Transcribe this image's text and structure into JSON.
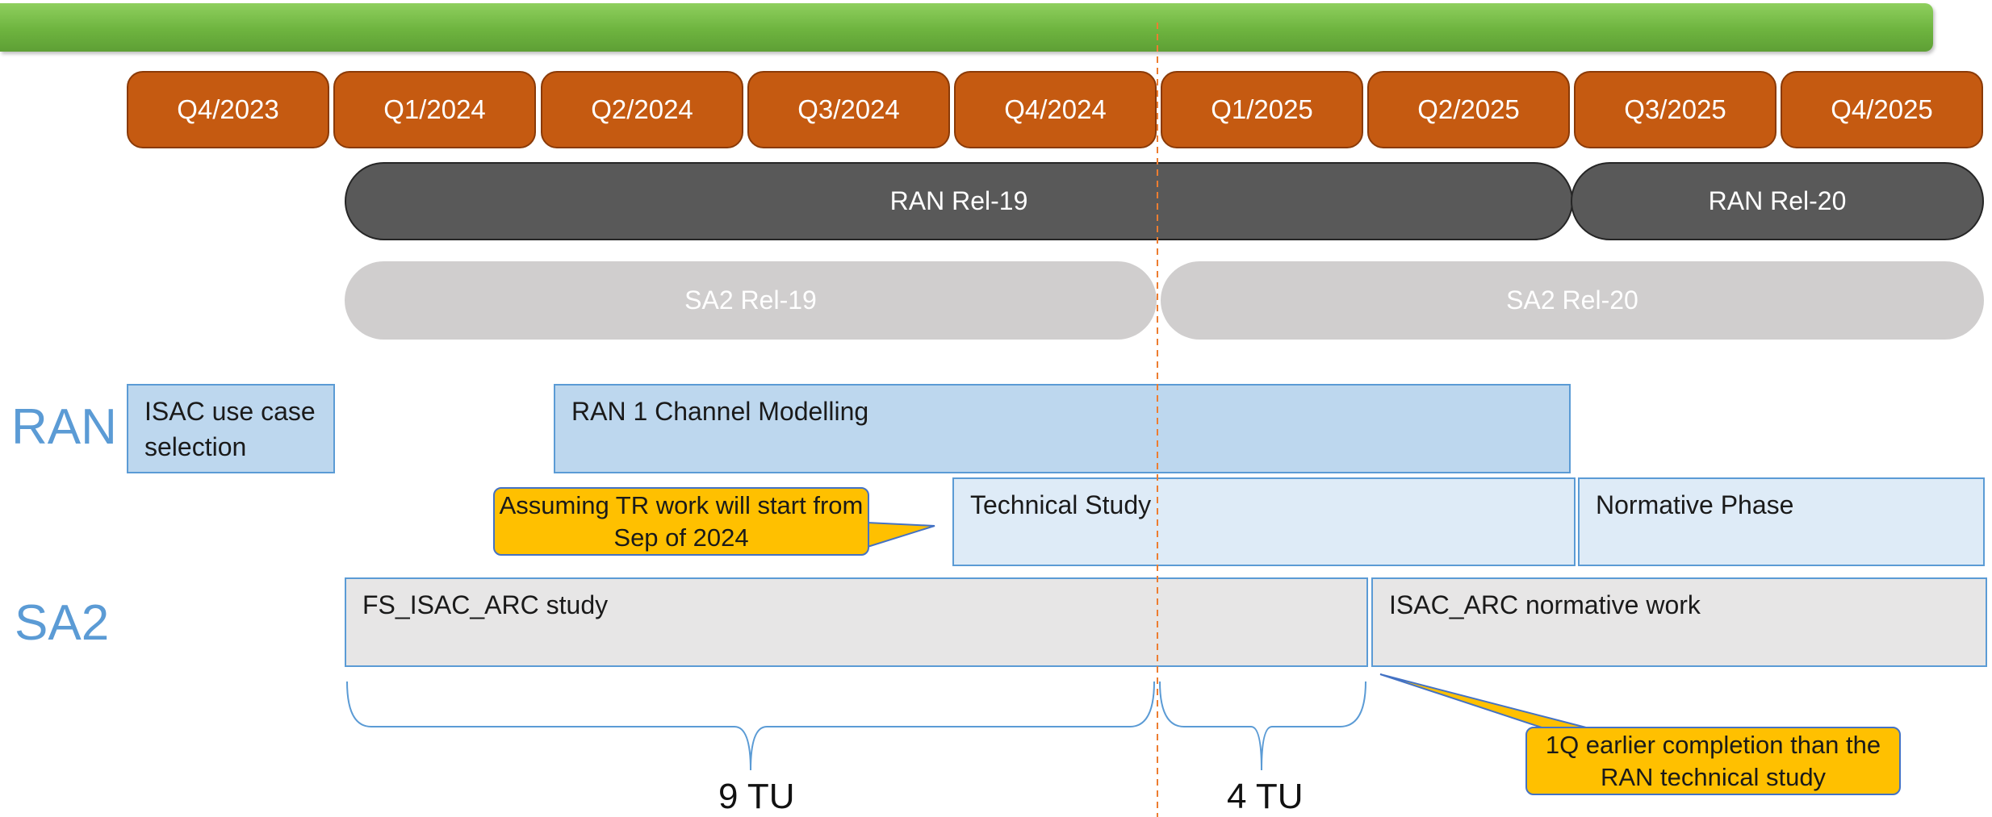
{
  "quarters": [
    "Q4/2023",
    "Q1/2024",
    "Q2/2024",
    "Q3/2024",
    "Q4/2024",
    "Q1/2025",
    "Q2/2025",
    "Q3/2025",
    "Q4/2025"
  ],
  "releases": {
    "ran_rel19": "RAN Rel-19",
    "ran_rel20": "RAN Rel-20",
    "sa2_rel19": "SA2 Rel-19",
    "sa2_rel20": "SA2 Rel-20"
  },
  "row_labels": {
    "ran": "RAN",
    "sa2": "SA2"
  },
  "boxes": {
    "isac_use_case": "ISAC use case selection",
    "ran1_channel": "RAN 1 Channel Modelling",
    "technical_study": "Technical Study",
    "normative_phase": "Normative Phase",
    "fs_isac_arc": "FS_ISAC_ARC study",
    "isac_arc_normative": "ISAC_ARC normative work"
  },
  "callouts": {
    "tr_assumption": "Assuming TR work will start from Sep of 2024",
    "earlier_completion": "1Q earlier completion than the RAN technical study"
  },
  "durations": {
    "first": "9 TU",
    "second": "4 TU"
  },
  "colors": {
    "quarter": "#c55a11",
    "ran_release": "#595959",
    "sa2_release": "#d0cece",
    "ran_box": "#bdd7ee",
    "callout": "#ffc000",
    "divider": "#ed7d31"
  }
}
